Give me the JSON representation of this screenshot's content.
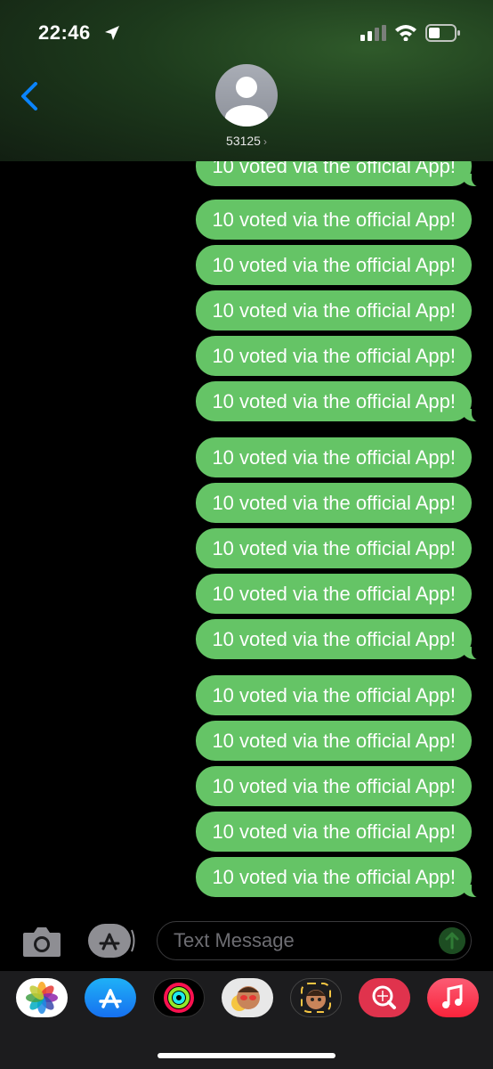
{
  "status_bar": {
    "time": "22:46",
    "icons": [
      "location-arrow-icon",
      "signal-icon",
      "wifi-icon",
      "battery-icon"
    ]
  },
  "header": {
    "contact_name": "53125",
    "chevron": "›",
    "icons": [
      "back-chevron-icon",
      "avatar-person-icon"
    ]
  },
  "messages": [
    {
      "text": "10 voted via the official App!"
    },
    {
      "text": "10 voted via the official App!"
    },
    {
      "text": "10 voted via the official App!"
    },
    {
      "text": "10 voted via the official App!"
    },
    {
      "text": "10 voted via the official App!"
    },
    {
      "text": "10 voted via the official App!"
    },
    {
      "text": "10 voted via the official App!"
    },
    {
      "text": "10 voted via the official App!"
    },
    {
      "text": "10 voted via the official App!"
    },
    {
      "text": "10 voted via the official App!"
    },
    {
      "text": "10 voted via the official App!"
    },
    {
      "text": "10 voted via the official App!"
    },
    {
      "text": "10 voted via the official App!"
    },
    {
      "text": "10 voted via the official App!"
    },
    {
      "text": "10 voted via the official App!"
    },
    {
      "text": "10 voted via the official App!"
    }
  ],
  "composer": {
    "placeholder": "Text Message",
    "icons": [
      "camera-icon",
      "app-store-icon",
      "send-arrow-icon"
    ]
  },
  "dock_apps": [
    "photos-icon",
    "app-store-icon",
    "fitness-rings-icon",
    "memoji-stickers-icon",
    "memoji-icon",
    "web-search-icon",
    "music-icon"
  ],
  "colors": {
    "bubble": "#65c466",
    "accent": "#0a84ff"
  }
}
